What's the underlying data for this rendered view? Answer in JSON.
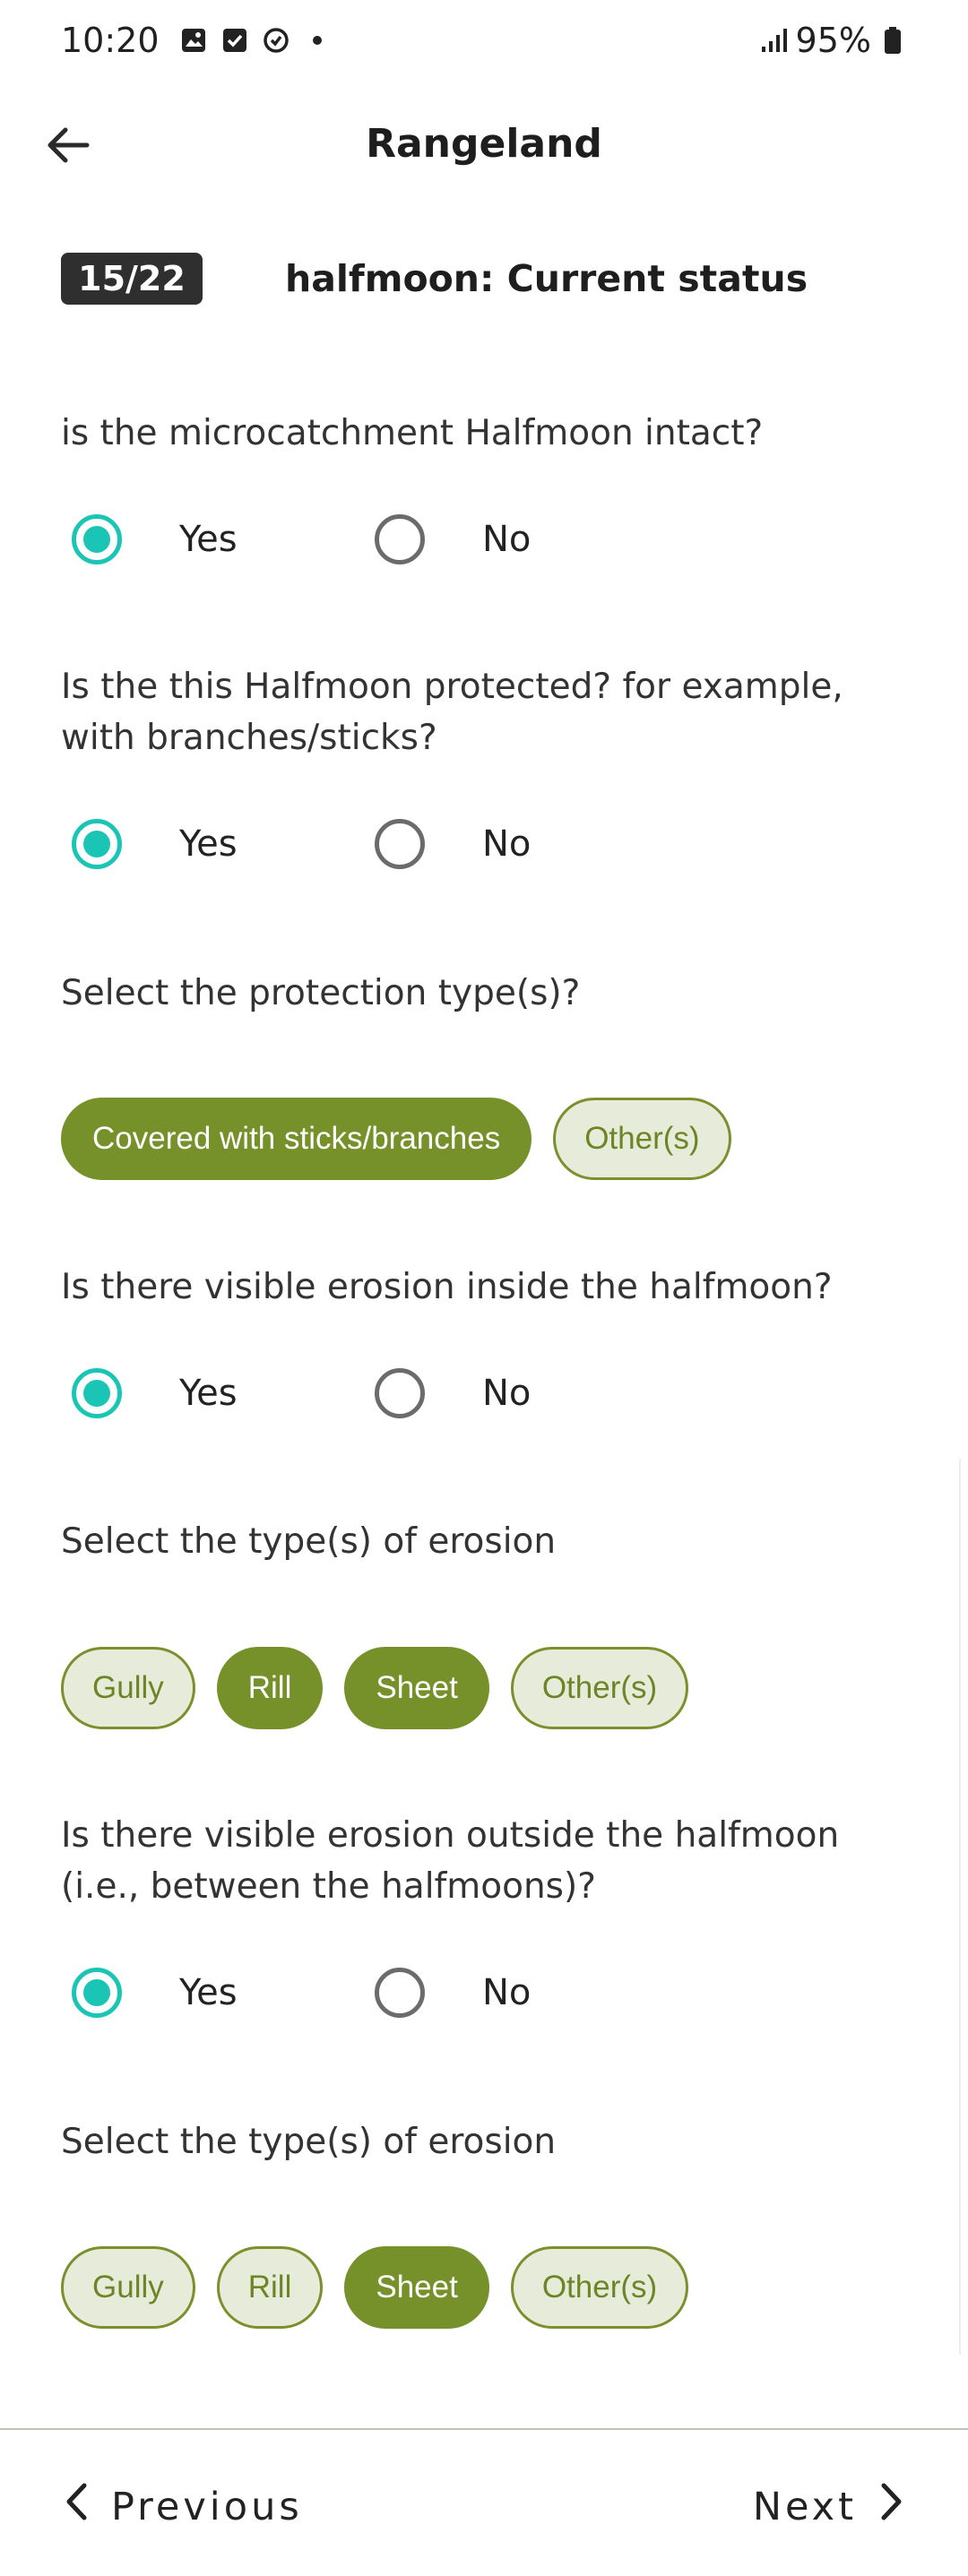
{
  "status_bar": {
    "time": "10:20",
    "battery": "95%"
  },
  "app_bar": {
    "title": "Rangeland"
  },
  "section": {
    "counter": "15/22",
    "title": "halfmoon: Current status"
  },
  "questions": [
    {
      "label": "is the microcatchment Halfmoon intact?",
      "type": "radio",
      "options": [
        "Yes",
        "No"
      ],
      "selected": "Yes"
    },
    {
      "label": "Is the this Halfmoon protected? for example, with branches/sticks?",
      "type": "radio",
      "options": [
        "Yes",
        "No"
      ],
      "selected": "Yes"
    },
    {
      "label": "Select the protection type(s)?",
      "type": "chips",
      "chips": [
        {
          "label": "Covered with sticks/branches",
          "selected": true
        },
        {
          "label": "Other(s)",
          "selected": false
        }
      ]
    },
    {
      "label": "Is there visible erosion inside the halfmoon?",
      "type": "radio",
      "options": [
        "Yes",
        "No"
      ],
      "selected": "Yes"
    },
    {
      "label": "Select the type(s) of erosion",
      "type": "chips",
      "chips": [
        {
          "label": "Gully",
          "selected": false
        },
        {
          "label": "Rill",
          "selected": true
        },
        {
          "label": "Sheet",
          "selected": true
        },
        {
          "label": "Other(s)",
          "selected": false
        }
      ]
    },
    {
      "label": "Is there visible erosion outside the halfmoon (i.e., between the halfmoons)?",
      "type": "radio",
      "options": [
        "Yes",
        "No"
      ],
      "selected": "Yes"
    },
    {
      "label": "Select the type(s) of erosion",
      "type": "chips",
      "chips": [
        {
          "label": "Gully",
          "selected": false
        },
        {
          "label": "Rill",
          "selected": false
        },
        {
          "label": "Sheet",
          "selected": true
        },
        {
          "label": "Other(s)",
          "selected": false
        }
      ]
    }
  ],
  "bottom_nav": {
    "previous": "Previous",
    "next": "Next"
  },
  "colors": {
    "radio_checked": "#1bc5b5",
    "chip_selected": "#76902a",
    "chip_unselected_bg": "#e6ebda",
    "counter_bg": "#2f2f2f"
  },
  "icons": {
    "back": "arrow-left-icon",
    "previous": "chevron-left-icon",
    "next": "chevron-right-icon"
  }
}
